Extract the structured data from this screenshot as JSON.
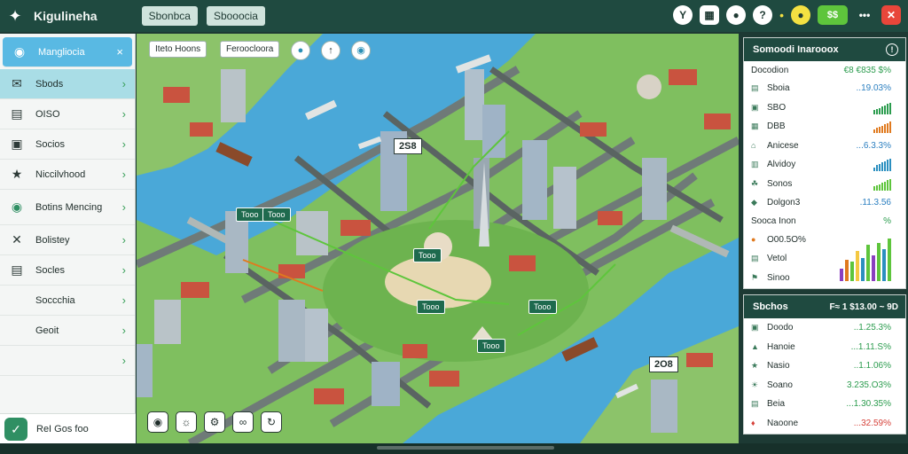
{
  "header": {
    "title": "Kigulineha",
    "tabs": [
      "Sbonbca",
      "Sbooocia"
    ],
    "icons": [
      "tree-icon",
      "calendar-icon",
      "chat-icon",
      "help-icon",
      "coin-icon",
      "cash-icon",
      "more-icon",
      "close-icon"
    ],
    "cash_label": "$$"
  },
  "sidebar": {
    "items": [
      {
        "label": "Mangliocia",
        "icon": "globe-icon"
      },
      {
        "label": "Sbods",
        "icon": "mail-icon"
      },
      {
        "label": "OISO",
        "icon": "document-icon"
      },
      {
        "label": "Socios",
        "icon": "building-icon"
      },
      {
        "label": "Niccilvhood",
        "icon": "people-icon"
      },
      {
        "label": "Botins Mencing",
        "icon": "world-icon"
      },
      {
        "label": "Bolistey",
        "icon": "tools-icon"
      },
      {
        "label": "Socles",
        "icon": "table-icon"
      },
      {
        "label": "Soccchia",
        "icon": ""
      },
      {
        "label": "Geoit",
        "icon": ""
      },
      {
        "label": "",
        "icon": ""
      }
    ],
    "footer": "ReI Gos foo"
  },
  "map": {
    "toolbar_pills": [
      "Iteto Hoons",
      "Feroocloora"
    ],
    "tags": [
      "2S8",
      "Tooo",
      "Tooo",
      "Tooo",
      "Tooo",
      "Tooo",
      "Tooo",
      "2O8"
    ],
    "bottom_buttons": [
      "pin-icon",
      "bulb-icon",
      "gear-icon",
      "link-icon",
      "refresh-icon"
    ]
  },
  "stats_panel": {
    "title": "Somoodi Inarooox",
    "summary_label": "Docodion",
    "summary_value": "€8 €835 $%",
    "rows": [
      {
        "label": "Sboia",
        "value": "..19.03%",
        "icon": "chart-icon"
      },
      {
        "label": "SBO",
        "value": "",
        "icon": "ticket-icon",
        "bar_color": "#2b9c4e",
        "bars": [
          0.3,
          0.4,
          0.5,
          0.6,
          0.7,
          0.8,
          0.9
        ]
      },
      {
        "label": "DBB",
        "value": "",
        "icon": "box-icon",
        "bar_color": "#e07a1f",
        "bars": [
          0.3,
          0.4,
          0.5,
          0.6,
          0.7,
          0.8,
          0.9
        ]
      },
      {
        "label": "Anicese",
        "value": "...6.3.3%",
        "icon": "home-icon"
      },
      {
        "label": "Alvidoy",
        "value": "",
        "icon": "bar-icon",
        "bar_color": "#2b8fc0",
        "bars": [
          0.3,
          0.5,
          0.6,
          0.7,
          0.8,
          0.9,
          1.0
        ]
      },
      {
        "label": "Sonos",
        "value": "",
        "icon": "leaf-icon",
        "bar_color": "#5ec53c",
        "bars": [
          0.3,
          0.4,
          0.5,
          0.6,
          0.7,
          0.8,
          0.9
        ]
      },
      {
        "label": "Dolgon3",
        "value": ".11.3.56",
        "icon": "diamond-icon"
      }
    ],
    "sub_label": "Sooca Inon",
    "sub_value": "%",
    "sub_rows": [
      {
        "label": "O00.5O%",
        "icon": "coin-icon"
      },
      {
        "label": "Vetol",
        "icon": "chart-icon"
      },
      {
        "label": "Sinoo",
        "icon": "flag-icon"
      }
    ],
    "chart_bars": [
      {
        "value": 0.3,
        "color": "#8a3fbf"
      },
      {
        "value": 0.5,
        "color": "#e07a1f"
      },
      {
        "value": 0.45,
        "color": "#5ec53c"
      },
      {
        "value": 0.7,
        "color": "#f4c842"
      },
      {
        "value": 0.55,
        "color": "#2b8fc0"
      },
      {
        "value": 0.85,
        "color": "#5ec53c"
      },
      {
        "value": 0.6,
        "color": "#8a3fbf"
      },
      {
        "value": 0.9,
        "color": "#5ec53c"
      },
      {
        "value": 0.75,
        "color": "#2b8fc0"
      },
      {
        "value": 1.0,
        "color": "#5ec53c"
      }
    ]
  },
  "resources_panel": {
    "title": "Sbchos",
    "value": "F≈ 1 $13.00 ~ 9D",
    "rows": [
      {
        "label": "Doodo",
        "value": "..1.25.3%",
        "color": "green",
        "icon": "tag-icon"
      },
      {
        "label": "Hanoie",
        "value": "...1.11.S%",
        "color": "green",
        "icon": "bell-icon"
      },
      {
        "label": "Nasio",
        "value": "..1.1.06%",
        "color": "green",
        "icon": "star-icon"
      },
      {
        "label": "Soano",
        "value": "3.235.O3%",
        "color": "green",
        "icon": "sun-icon"
      },
      {
        "label": "Beia",
        "value": "...1.30.35%",
        "color": "green",
        "icon": "cart-icon"
      },
      {
        "label": "Naoone",
        "value": "...32.59%",
        "color": "red",
        "icon": "alert-icon"
      }
    ]
  }
}
